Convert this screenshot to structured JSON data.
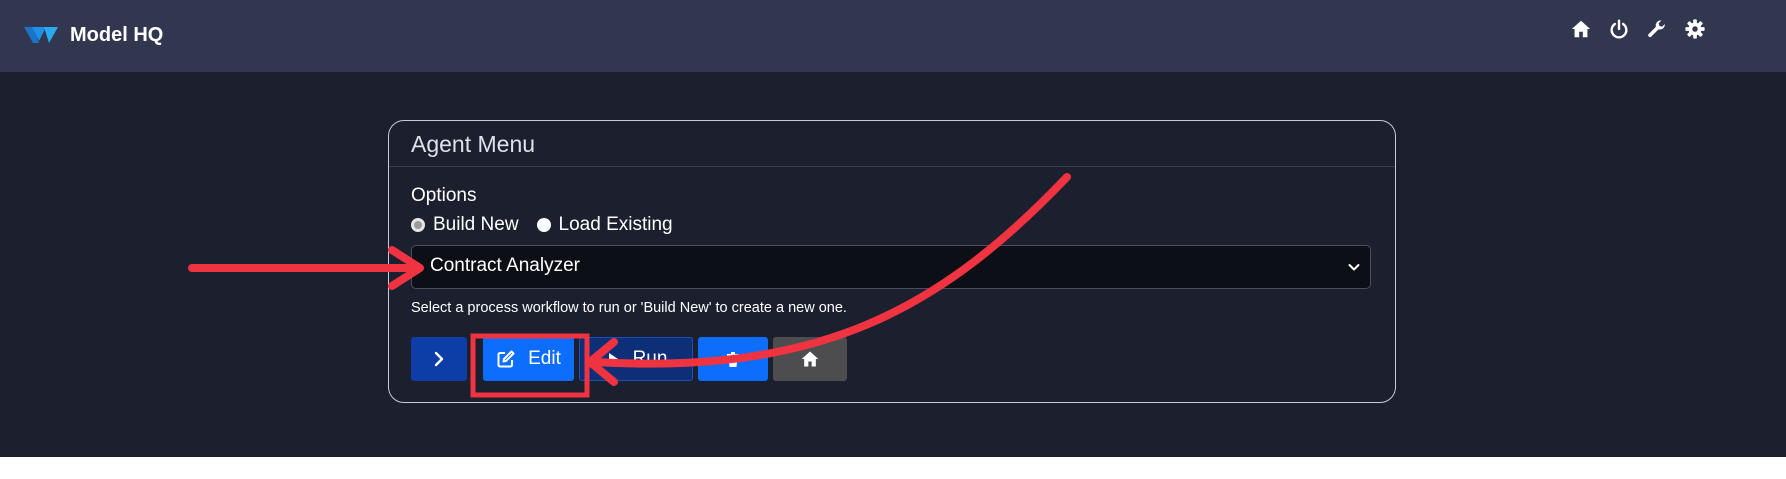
{
  "app": {
    "title": "Model HQ"
  },
  "topnav": {
    "icons": [
      "home-icon",
      "power-icon",
      "wrench-icon",
      "gear-icon"
    ]
  },
  "agent_menu": {
    "title": "Agent Menu",
    "options_label": "Options",
    "radio_options": [
      {
        "label": "Build New",
        "checked": true
      },
      {
        "label": "Load Existing",
        "checked": false
      }
    ],
    "select_value": "Contract Analyzer",
    "help_text": "Select a process workflow to run or 'Build New' to create a new one.",
    "buttons": {
      "next_icon": "chevron-right-icon",
      "edit_label": "Edit",
      "run_label": "Run",
      "delete_icon": "trash-icon",
      "home_icon": "home-icon"
    }
  },
  "colors": {
    "topbar": "#323750",
    "main_bg": "#1c1f2e",
    "primary": "#0d6efd",
    "annotation_red": "#ef3340"
  }
}
